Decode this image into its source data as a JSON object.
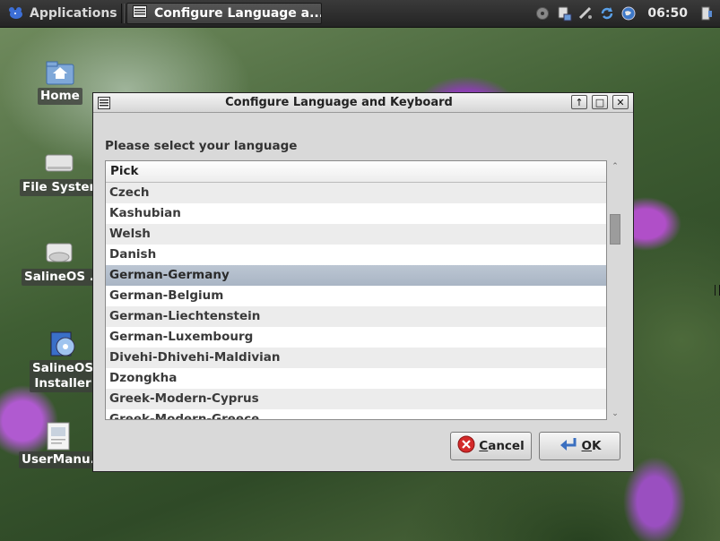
{
  "panel": {
    "applications_label": "Applications",
    "task_title": "Configure Language a...",
    "clock": "06:50"
  },
  "desktop": {
    "icons": [
      {
        "label": "Home"
      },
      {
        "label": "File Syster"
      },
      {
        "label": "SalineOS ."
      },
      {
        "label_line1": "SalineOS",
        "label_line2": "Installer"
      },
      {
        "label": "UserManu."
      }
    ]
  },
  "dialog": {
    "title": "Configure Language and Keyboard",
    "prompt": "Please select your language",
    "list_header": "Pick",
    "languages": [
      "Czech",
      "Kashubian",
      "Welsh",
      "Danish",
      "German-Germany",
      "German-Belgium",
      "German-Liechtenstein",
      "German-Luxembourg",
      "Divehi-Dhivehi-Maldivian",
      "Dzongkha",
      "Greek-Modern-Cyprus",
      "Greek-Modern-Greece"
    ],
    "selected_language": "German-Germany",
    "cancel_label_underlined": "C",
    "cancel_label_rest": "ancel",
    "ok_label_underlined": "O",
    "ok_label_rest": "K"
  },
  "colors": {
    "selection": "#aeb9c8",
    "panel": "#2e2e2e",
    "cancel_icon": "#d42a2a",
    "ok_icon": "#3a6fc0"
  },
  "icons": {
    "applications": "mouse-logo-icon",
    "task": "window-icon",
    "tray": [
      "cd-drive-icon",
      "usb-drive-icon",
      "network-icon",
      "update-refresh-icon",
      "globe-icon",
      "exit-icon"
    ],
    "cancel": "cancel-x-icon",
    "ok": "ok-return-arrow-icon"
  }
}
